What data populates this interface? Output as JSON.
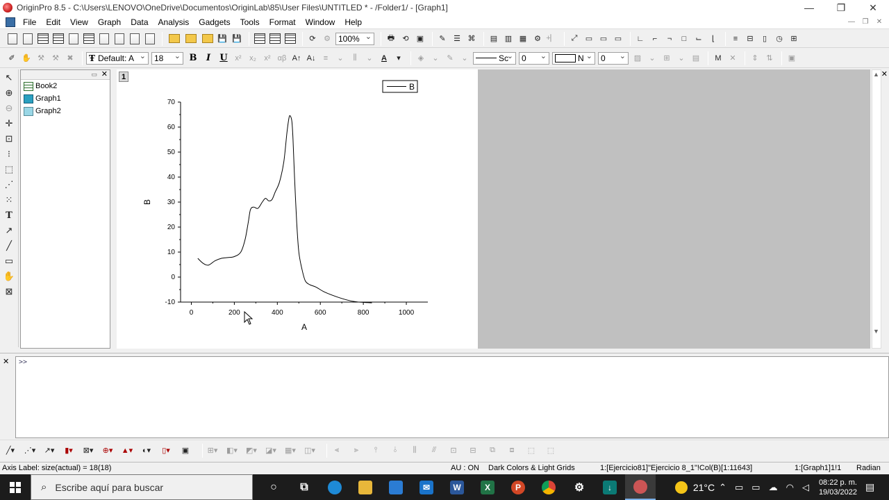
{
  "window": {
    "title": "OriginPro 8.5 - C:\\Users\\LENOVO\\OneDrive\\Documentos\\OriginLab\\85\\User Files\\UNTITLED * - /Folder1/ - [Graph1]",
    "controls": [
      "—",
      "❐",
      "✕"
    ]
  },
  "menu": [
    "File",
    "Edit",
    "View",
    "Graph",
    "Data",
    "Analysis",
    "Gadgets",
    "Tools",
    "Format",
    "Window",
    "Help"
  ],
  "toolbar": {
    "zoom": "100%",
    "font_name": "Default: A",
    "font_size": "18",
    "bold": "B",
    "italic": "I",
    "underline": "U",
    "line_style": "Sc",
    "line_width": "0",
    "fill_pattern": "N",
    "fill_width": "0"
  },
  "project": {
    "items": [
      {
        "label": "Book2",
        "icon": "workbook-icon"
      },
      {
        "label": "Graph1",
        "icon": "graph-icon"
      },
      {
        "label": "Graph2",
        "icon": "graph-icon"
      }
    ]
  },
  "graph": {
    "layer": "1"
  },
  "chart_data": {
    "type": "line",
    "xlabel": "A",
    "ylabel": "B",
    "xlim": [
      -50,
      1100
    ],
    "ylim": [
      -10,
      70
    ],
    "xticks": [
      0,
      200,
      400,
      600,
      800,
      1000
    ],
    "yticks": [
      -10,
      0,
      10,
      20,
      30,
      40,
      50,
      60,
      70
    ],
    "legend": {
      "position": "top-right"
    },
    "grid": false,
    "series": [
      {
        "name": "B",
        "color": "#000000",
        "x": [
          30,
          55,
          80,
          110,
          140,
          170,
          200,
          230,
          250,
          265,
          275,
          290,
          310,
          330,
          345,
          360,
          375,
          390,
          410,
          430,
          445,
          455,
          462,
          468,
          473,
          480,
          490,
          500,
          515,
          530,
          550,
          580,
          620,
          680,
          740,
          780,
          820,
          840
        ],
        "y": [
          7.5,
          5.5,
          4.8,
          6.5,
          7.5,
          7.8,
          8.2,
          10,
          15,
          22,
          27,
          28,
          27.5,
          30,
          31.5,
          30.5,
          31,
          34,
          38,
          46,
          58,
          64,
          64.2,
          62,
          55,
          40,
          22,
          10,
          3,
          -1.5,
          -3,
          -4,
          -6,
          -8,
          -9.5,
          -10,
          -10.2,
          -10.3
        ]
      }
    ]
  },
  "command": {
    "prompt": ">>"
  },
  "status": {
    "axis_label": "Axis Label: size(actual) = 18(18)",
    "au": "AU : ON",
    "theme": "Dark Colors & Light Grids",
    "column": "1:[Ejercicio81]\"Ejercicio 8_1\"!Col(B)[1:11643]",
    "layer": "1:[Graph1]1!1",
    "angle": "Radian"
  },
  "taskbar": {
    "search_placeholder": "Escribe aquí para buscar",
    "temperature": "21°C",
    "time": "08:22 p. m.",
    "date": "19/03/2022"
  }
}
